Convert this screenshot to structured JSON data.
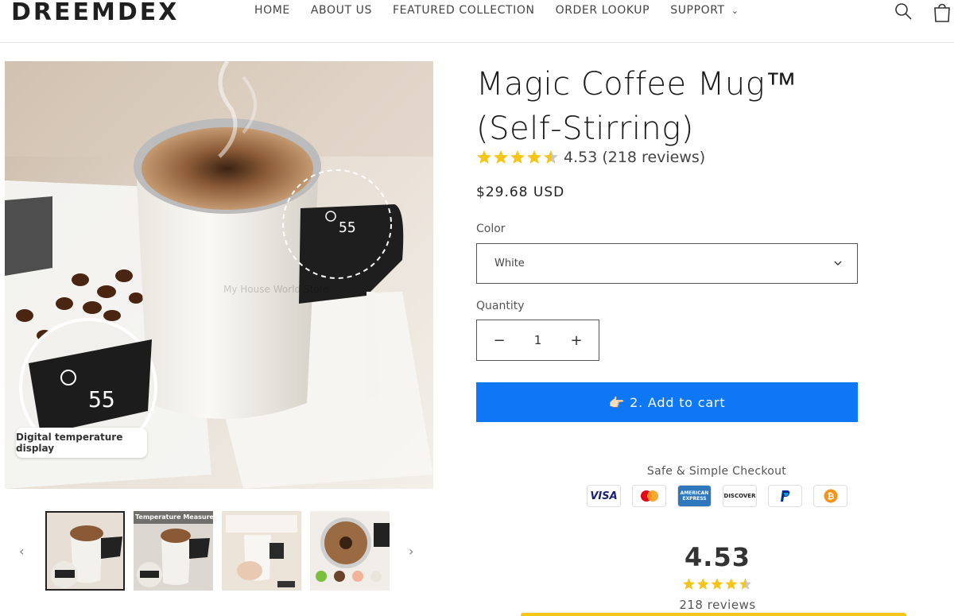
{
  "header": {
    "logo": "DREEMDEX",
    "nav": [
      {
        "label": "HOME"
      },
      {
        "label": "ABOUT US"
      },
      {
        "label": "FEATURED COLLECTION"
      },
      {
        "label": "ORDER LOOKUP"
      },
      {
        "label": "SUPPORT"
      }
    ],
    "search_icon": "search-icon",
    "cart_icon": "cart-icon"
  },
  "gallery": {
    "watermark": "My House World Store",
    "display_label": "Digital temperature display",
    "thumbnails": [
      {
        "caption": "",
        "active": true
      },
      {
        "caption": "Temperature Measurement",
        "active": false
      },
      {
        "caption": "",
        "active": false
      },
      {
        "caption": "",
        "active": false
      }
    ],
    "prev_icon": "chevron-left-icon",
    "next_icon": "chevron-right-icon"
  },
  "product": {
    "title": "Magic Coffee Mug™ (Self-Stirring)",
    "rating_text": "4.53 (218 reviews)",
    "rating_value": 4.53,
    "price": "$29.68 USD",
    "color_label": "Color",
    "color_value": "White",
    "quantity_label": "Quantity",
    "quantity_value": "1",
    "add_to_cart": "👉🏻 2. Add to cart"
  },
  "checkout": {
    "title": "Safe & Simple Checkout",
    "methods": [
      "VISA",
      "Mastercard",
      "AMERICAN EXPRESS",
      "DISCOVER",
      "PayPal",
      "Bitcoin"
    ]
  },
  "reviews": {
    "average": "4.53",
    "count_text": "218 reviews"
  },
  "colors": {
    "accent": "#0d77f5",
    "star": "#f5c518"
  }
}
